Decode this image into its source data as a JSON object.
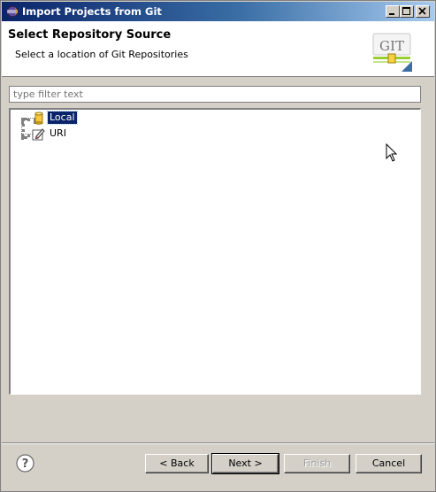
{
  "window": {
    "title": "Import Projects from Git"
  },
  "header": {
    "title": "Select Repository Source",
    "subtitle": "Select a location of Git Repositories",
    "logo_text": "GIT"
  },
  "filter": {
    "placeholder": "type filter text",
    "value": ""
  },
  "tree": {
    "items": [
      {
        "label": "Local",
        "icon": "repository-cylinder-icon",
        "selected": true
      },
      {
        "label": "URI",
        "icon": "uri-edit-icon",
        "selected": false
      }
    ]
  },
  "buttons": {
    "back": "< Back",
    "next": "Next >",
    "finish": "Finish",
    "cancel": "Cancel"
  },
  "colors": {
    "titlebar_start": "#0a246a",
    "titlebar_end": "#a6caf0",
    "selection": "#0a246a",
    "dialog_bg": "#d4d0c8"
  }
}
